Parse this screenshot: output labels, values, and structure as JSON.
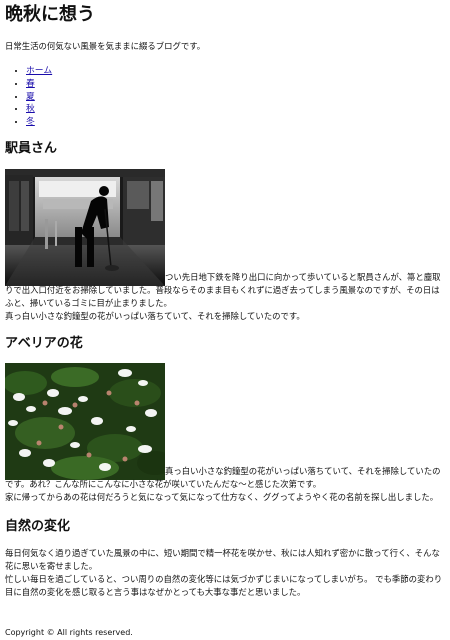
{
  "site": {
    "title": "晩秋に想う",
    "tagline": "日常生活の何気ない風景を気ままに綴るブログです。"
  },
  "nav": {
    "items": [
      {
        "label": "ホーム"
      },
      {
        "label": "春"
      },
      {
        "label": "夏"
      },
      {
        "label": "秋"
      },
      {
        "label": "冬"
      }
    ]
  },
  "articles": [
    {
      "title": "駅員さん",
      "line1": "つい先日地下鉄を降り出口に向かって歩いていると駅員さんが、箒と塵取りで出入口付近をお掃除していました。普段ならそのまま目もくれずに過ぎ去ってしまう風景なのですが、その日はふと、掃いているゴミに目が止まりました。",
      "line2": "真っ白い小さな釣鐘型の花がいっぱい落ちていて、それを掃除していたのです。"
    },
    {
      "title": "アベリアの花",
      "line1": "真っ白い小さな釣鐘型の花がいっぱい落ちていて、それを掃除していたのです。あれ？こんな所にこんなに小さな花が咲いていたんだな〜と感じた次第です。",
      "line2": "家に帰ってからあの花は何だろうと気になって気になって仕方なく、ググってようやく花の名前を探し出しました。"
    },
    {
      "title": "自然の変化",
      "line1": "毎日何気なく過り過ぎていた風景の中に、短い期間で精一杯花を咲かせ、秋には人知れず密かに散って行く、そんな花に思いを寄せました。",
      "line2": "忙しい毎日を過ごしていると、つい周りの自然の変化等には気づかずじまいになってしまいがち。 でも季節の変わり目に自然の変化を感じ取ると言う事はなぜかとっても大事な事だと思いました。"
    }
  ],
  "footer": {
    "text": "Copyright © All rights reserved."
  }
}
